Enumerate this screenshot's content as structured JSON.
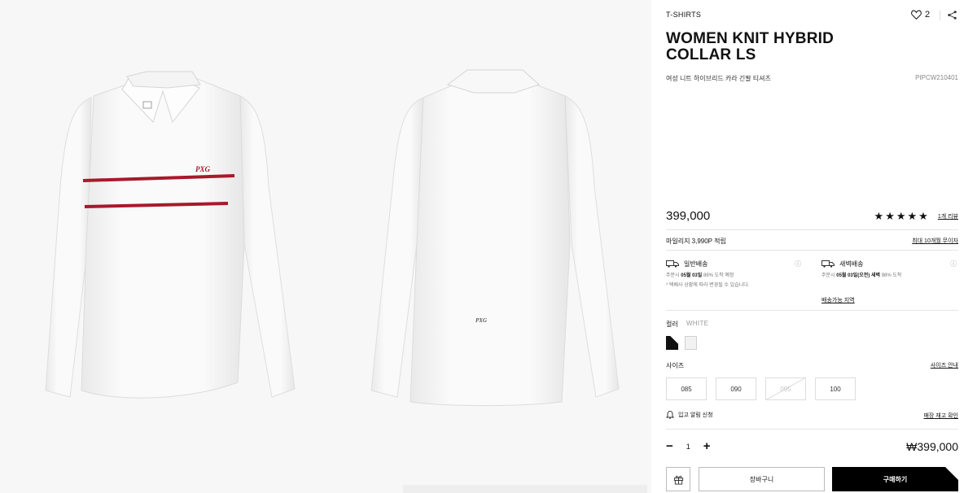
{
  "product": {
    "category": "T-SHIRTS",
    "likes": "2",
    "title_line1": "WOMEN KNIT HYBRID",
    "title_line2": "COLLAR LS",
    "subtitle": "여성 니트 하이브리드 카라 긴팔 티셔츠",
    "code": "PIPCW210401"
  },
  "pricing": {
    "price": "399,000",
    "stars": "★★★★★",
    "review_count": "1개 리뷰",
    "mileage": "마일리지 3,990P 적립",
    "installment": "최대 10개월 무이자"
  },
  "shipping": {
    "standard": {
      "title": "일반배송",
      "line1_prefix": "주문시",
      "line1_bold": "05월 03일",
      "line1_suffix": "89% 도착 예정",
      "line2": "* 택배사 상황에 따라 변경될 수 있습니다."
    },
    "dawn": {
      "title": "새벽배송",
      "line1_prefix": "주문시",
      "line1_bold": "05월 03일(오전) 새벽",
      "line1_suffix": "98% 도착"
    },
    "area_link": "배송가능 지역"
  },
  "options": {
    "color_label": "컬러",
    "color_value": "WHITE",
    "swatches": [
      "#111111",
      "#f2f2f2"
    ],
    "size_label": "사이즈",
    "size_guide": "사이즈 안내",
    "sizes": [
      "085",
      "090",
      "095",
      "100"
    ],
    "size_sold_out": [
      false,
      false,
      true,
      false
    ]
  },
  "restock": {
    "alert": "입고 알림 신청",
    "store_stock": "매장 재고 확인"
  },
  "quantity": {
    "minus": "−",
    "value": "1",
    "plus": "+"
  },
  "total": "₩399,000",
  "actions": {
    "cart": "장바구니",
    "buy": "구매하기"
  },
  "images": {
    "front_logo": "PXG",
    "back_logo": "PXG",
    "stripe_color": "#a8192b",
    "shirt_color": "#ffffff"
  }
}
